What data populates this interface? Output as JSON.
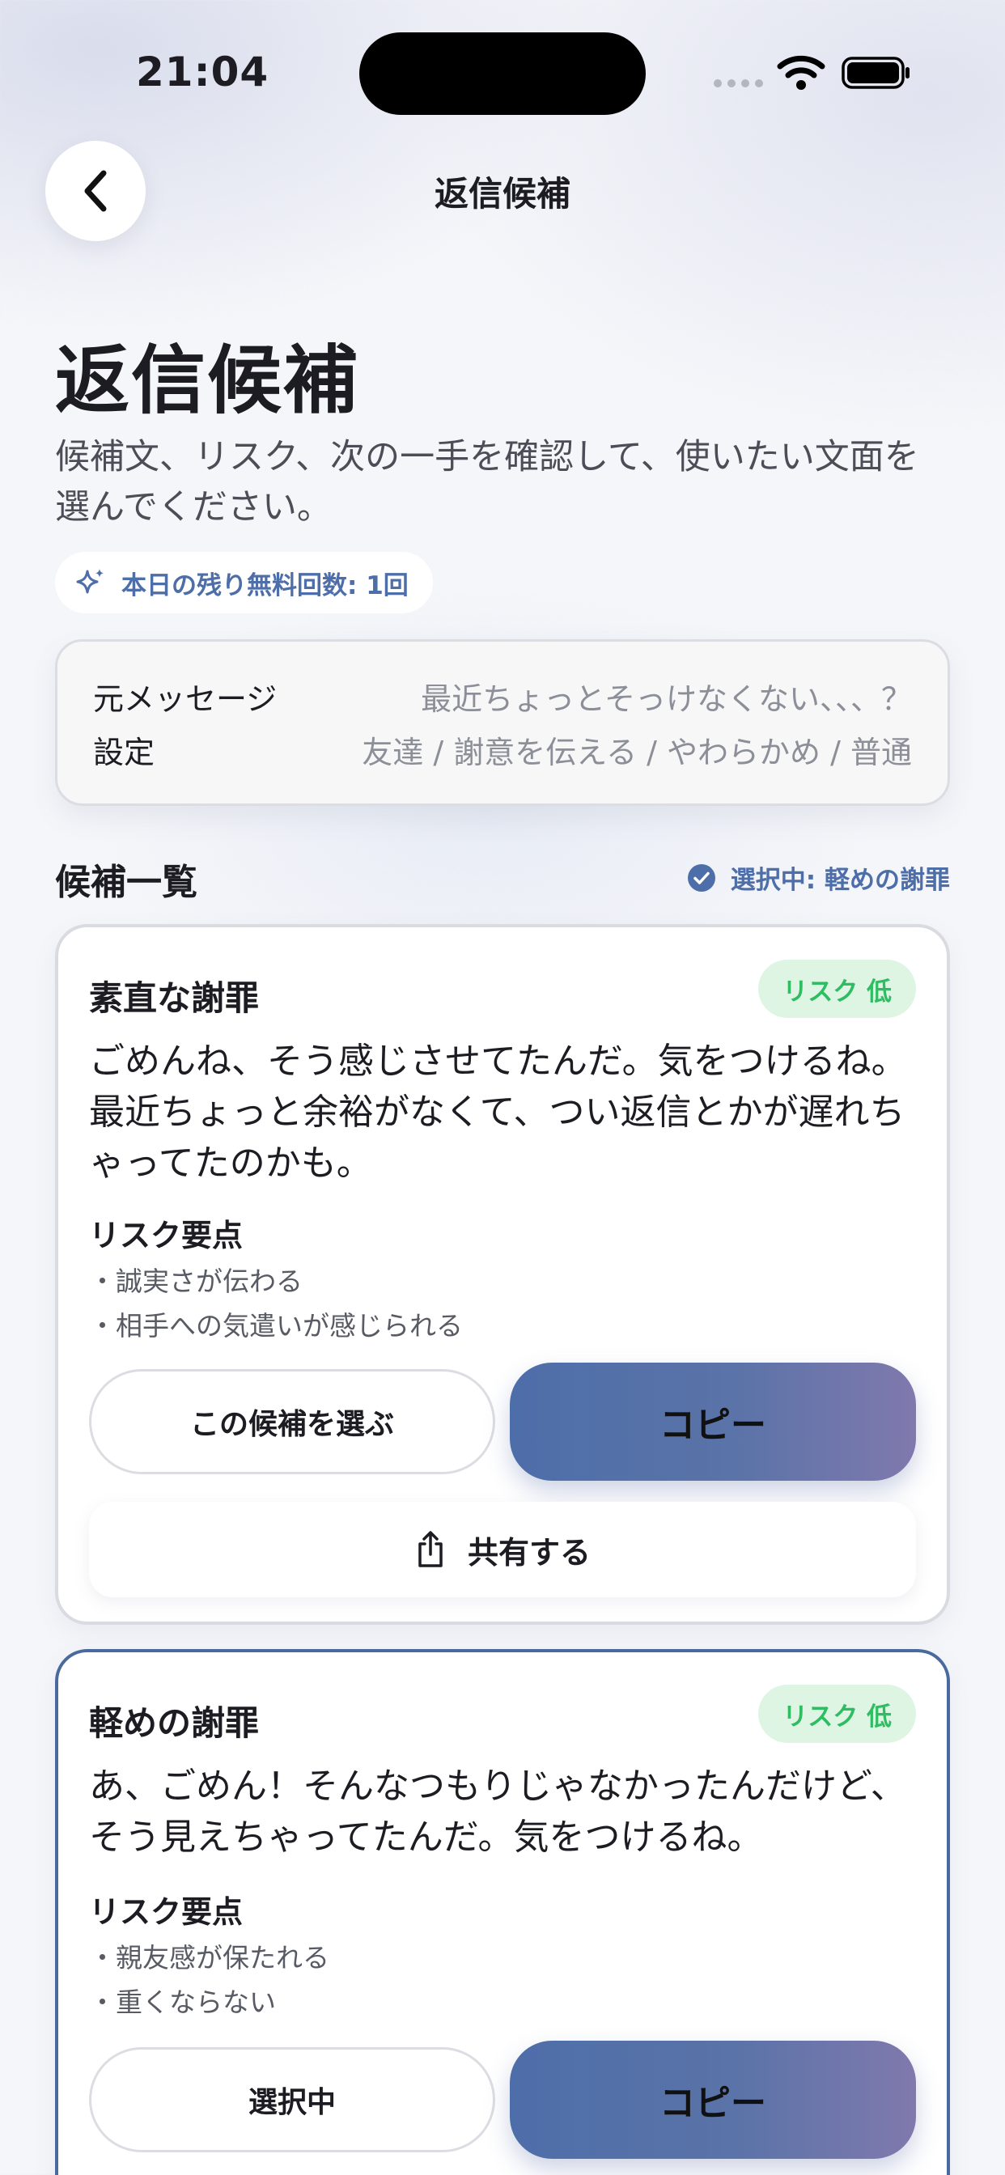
{
  "status_bar": {
    "time": "21:04"
  },
  "nav": {
    "title": "返信候補"
  },
  "header": {
    "title": "返信候補",
    "description": "候補文、リスク、次の一手を確認して、使いたい文面を選んでください。",
    "quota": "本日の残り無料回数: 1回"
  },
  "source": {
    "message_label": "元メッセージ",
    "message_value": "最近ちょっとそっけなくない、、、？",
    "settings_label": "設定",
    "settings_value": "友達 / 謝意を伝える / やわらかめ / 普通"
  },
  "list": {
    "title": "候補一覧",
    "selected": "選択中: 軽めの謝罪"
  },
  "candidates": [
    {
      "title": "素直な謝罪",
      "risk": "リスク 低",
      "body": "ごめんね、そう感じさせてたんだ。気をつけるね。最近ちょっと余裕がなくて、つい返信とかが遅れちゃってたのかも。",
      "risk_label": "リスク要点",
      "points": [
        "・誠実さが伝わる",
        "・相手への気遣いが感じられる"
      ],
      "select_label": "この候補を選ぶ",
      "copy_label": "コピー",
      "share_label": "共有する"
    },
    {
      "title": "軽めの謝罪",
      "risk": "リスク 低",
      "body": "あ、ごめん！そんなつもりじゃなかったんだけど、そう見えちゃってたんだ。気をつけるね。",
      "risk_label": "リスク要点",
      "points": [
        "・親友感が保たれる",
        "・重くならない"
      ],
      "select_label": "選択中",
      "copy_label": "コピー"
    }
  ],
  "colors": {
    "accent": "#4d6ea8",
    "risk_low_bg": "#dff5e4",
    "risk_low_text": "#2fbc62",
    "selected_border": "#4a6a9e"
  },
  "icons": {
    "back": "chevron-left-icon",
    "quota": "sparkle-icon",
    "selected": "check-circle-icon",
    "share": "share-icon"
  }
}
